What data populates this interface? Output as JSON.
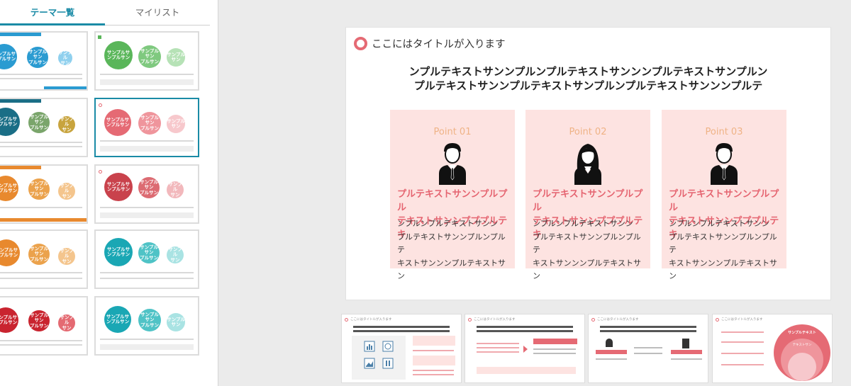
{
  "tabs": {
    "theme": "テーマ一覧",
    "mylist": "マイリスト"
  },
  "left_thumbnails": [
    {
      "id": "blue",
      "accent": "#2a9bd1",
      "circles": [
        "サンプルサ\nンプルサン",
        "サンプルサン\nプルサン",
        "サンプル\nサン"
      ]
    },
    {
      "id": "green",
      "accent": "#5ab65a",
      "circles": [
        "サンプルサ\nンプルサン",
        "サンプルサン\nプルサン",
        "サンプル\nサン"
      ]
    },
    {
      "id": "teal",
      "accent": "#1a8ba6",
      "circles": [
        "サンプルサ\nンプルサン",
        "サンプルサン\nプルサン",
        "サンプル\nサン"
      ]
    },
    {
      "id": "pink",
      "accent": "#e56a74",
      "circles": [
        "サンプルサ\nンプルサン",
        "サンプルサン\nプルサン",
        "サンプル\nサン"
      ]
    },
    {
      "id": "orange",
      "accent": "#e8892e",
      "circles": [
        "サンプルサ\nンプルサン",
        "サンプルサン\nプルサン",
        "サンプル\nサン"
      ]
    },
    {
      "id": "red",
      "accent": "#c9424c",
      "circles": [
        "サンプルサ\nンプルサン",
        "サンプルサン\nプルサン",
        "サンプル\nサン"
      ]
    },
    {
      "id": "orange2",
      "accent": "#e8892e",
      "circles": [
        "サンプルサ\nンプルサン",
        "サンプルサン\nプルサン",
        "サンプル\nサン"
      ]
    },
    {
      "id": "teal2",
      "accent": "#1aa7b4",
      "circles": [
        "サンプルサ\nンプルサン",
        "サンプルサン\nプルサン",
        "サンプル\nサン"
      ]
    },
    {
      "id": "crimson",
      "accent": "#c9242f",
      "circles": [
        "サンプルサ\nンプルサン",
        "サンプルサン\nプルサン",
        "サンプル\nサン"
      ]
    },
    {
      "id": "teal3",
      "accent": "#1aa7b4",
      "circles": [
        "サンプルサ\nンプルサン",
        "サンプルサン\nプルサン",
        "サンプル\nサン"
      ]
    }
  ],
  "slide": {
    "title": "ここにはタイトルが入ります",
    "heading_line1": "ンプルテキストサンンプルンプルテキストサンンンプルテキストサンプルン",
    "heading_line2": "プルテキストサンンプルテキストサンプルンプルテキストサンンンプルテ",
    "points": [
      {
        "label": "Point 01",
        "sub1": "プルテキストサンンプルプル",
        "sub2": "テキストサンンプププルテキ",
        "body1": "ンプルンプルテキストサンン",
        "body2": "プルテキストサンンプルンプルテ",
        "body3": "キストサンンンプルテキストサン",
        "icon": "businessman-icon"
      },
      {
        "label": "Point 02",
        "sub1": "プルテキストサンンプルプル",
        "sub2": "テキストサンンプププルテキ",
        "body1": "ンプルンプルテキストサンン",
        "body2": "プルテキストサンンプルンプルテ",
        "body3": "キストサンンンプルテキストサン",
        "icon": "businesswoman-icon"
      },
      {
        "label": "Point 03",
        "sub1": "プルテキストサンンプルプル",
        "sub2": "テキストサンンプププルテキ",
        "body1": "ンプルンプルテキストサンン",
        "body2": "プルテキストサンンプルンプルテ",
        "body3": "キストサンンンプルテキストサン",
        "icon": "businessman-icon"
      }
    ]
  },
  "bottom_thumbnails": [
    {
      "title": "ここにはタイトルが入ります"
    },
    {
      "title": "ここにはタイトルが入ります"
    },
    {
      "title": "ここにはタイトルが入ります"
    },
    {
      "title": "ここにはタイトルが入ります",
      "center_label": "サンプルテキスト",
      "mid_label": "テキストサン"
    }
  ],
  "colors": {
    "accent": "#1a8ba6",
    "brand_pink": "#e56a74",
    "card_bg": "#fde3e1",
    "point_label": "#efb386"
  }
}
